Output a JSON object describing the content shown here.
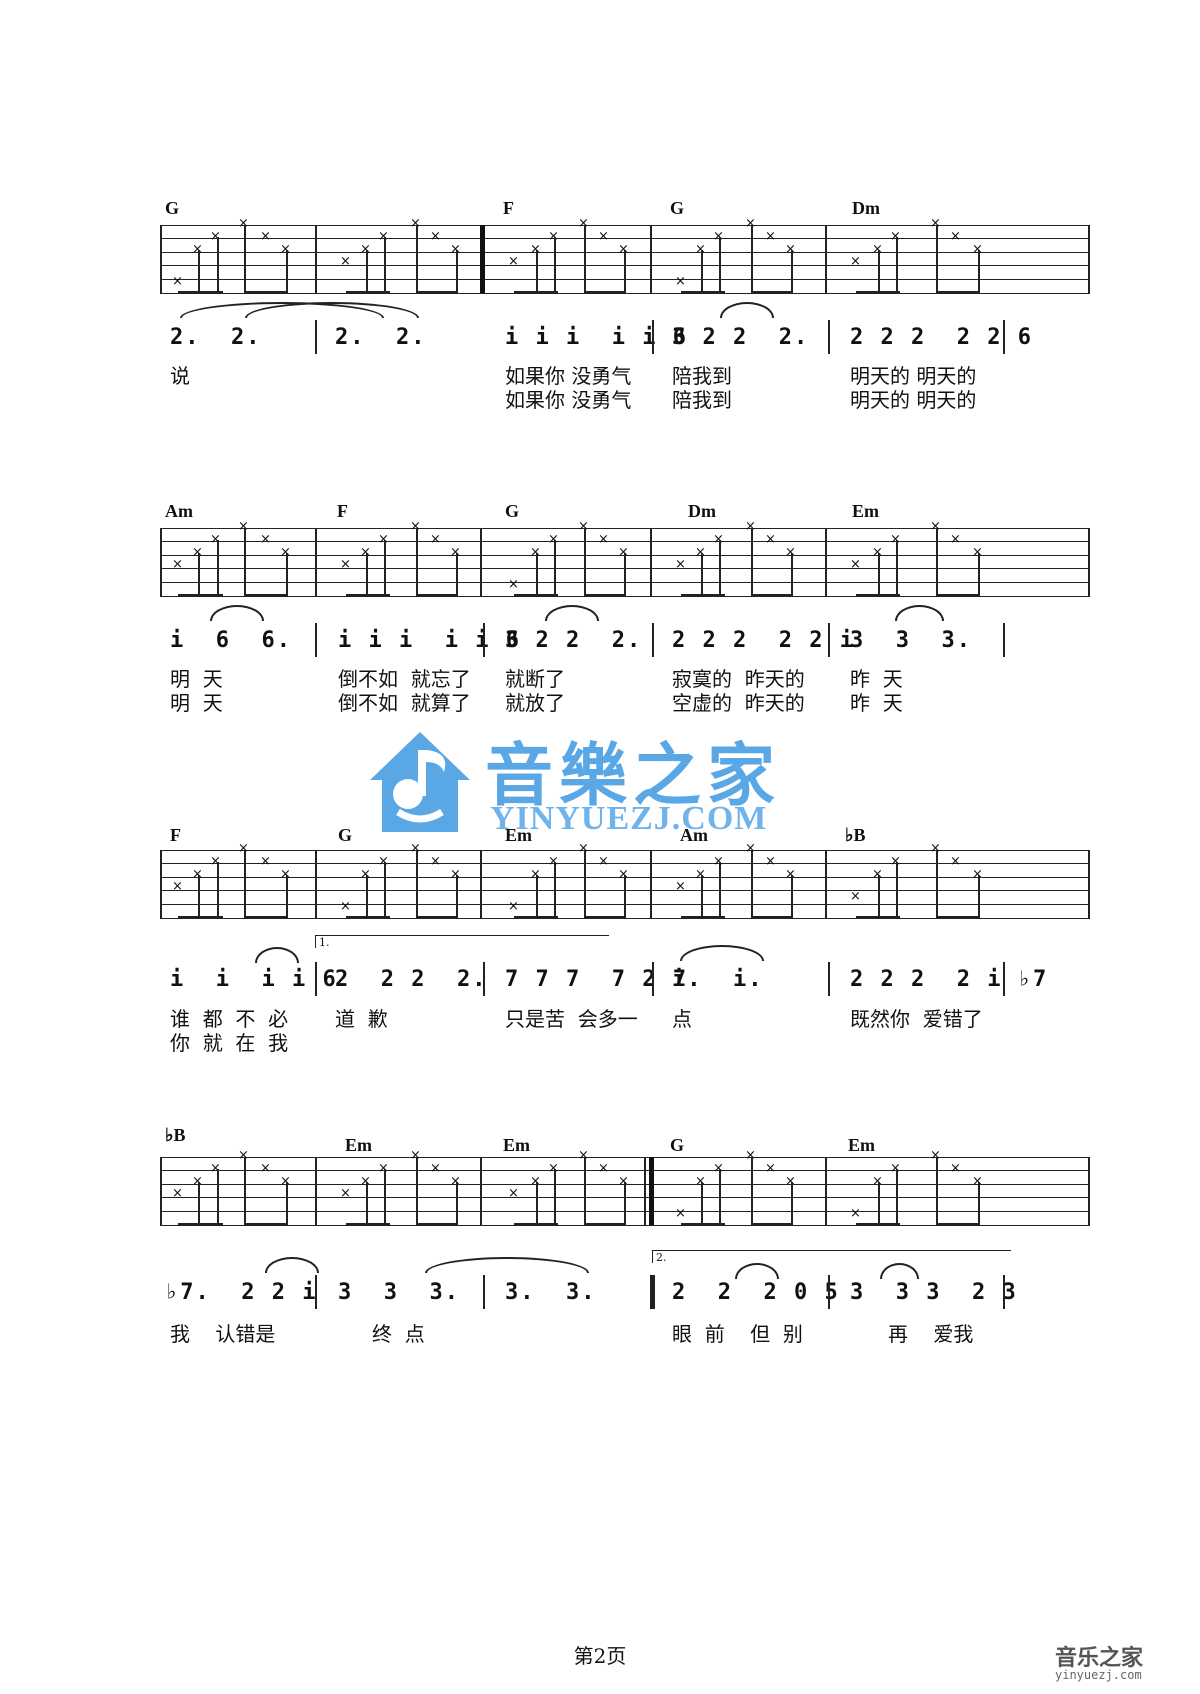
{
  "systems": [
    {
      "chords": [
        "G",
        "F",
        "G",
        "Dm"
      ],
      "jianpu_measures": [
        "2.  2.",
        "2.  2.",
        "i i i  i i 6",
        "3 2 2  2.",
        "2 2 2  2 2 6"
      ],
      "lyrics1": [
        "说",
        "如果你 没勇气",
        "陪我到",
        "明天的 明天的"
      ],
      "lyrics2": [
        "",
        "如果你 没勇气",
        "陪我到",
        "明天的 明天的"
      ]
    },
    {
      "chords": [
        "Am",
        "F",
        "G",
        "Dm",
        "Em"
      ],
      "jianpu_measures": [
        "i  6  6.",
        "i i i  i i 6",
        "3 2 2  2.",
        "2 2 2  2 2 i",
        "3  3  3."
      ],
      "lyrics1": [
        "明  天",
        "倒不如  就忘了",
        "就断了",
        "寂寞的  昨天的",
        "昨  天"
      ],
      "lyrics2": [
        "明  天",
        "倒不如  就算了",
        "就放了",
        "空虚的  昨天的",
        "昨  天"
      ]
    },
    {
      "chords": [
        "F",
        "G",
        "Em",
        "Am",
        "♭B"
      ],
      "ending_label": "1.",
      "jianpu_measures": [
        "i  i  i i 6",
        "2  2 2  2.",
        "7 7 7  7 2 7",
        "i.  i.",
        "2 2 2  2 i ♭7"
      ],
      "lyrics1": [
        "谁  都  不  必",
        "道  歉",
        "只是苦  会多一",
        "点",
        "既然你  爱错了"
      ],
      "lyrics2": [
        "你  就  在  我",
        "",
        "",
        "",
        ""
      ]
    },
    {
      "chords": [
        "♭B",
        "Em",
        "Em",
        "G",
        "Em"
      ],
      "ending_label": "2.",
      "jianpu_measures": [
        "♭7.  2 2 i",
        "3  3  3.",
        "3.  3.",
        "2  2  2 0 5",
        "3  3 3  2 3"
      ],
      "lyrics1": [
        "我    认错是",
        "终  点",
        "",
        "眼  前    但  别",
        "再    爱我"
      ],
      "lyrics2": [
        "",
        "",
        "",
        "",
        ""
      ]
    }
  ],
  "watermark": {
    "brand": "音樂之家",
    "url": "YINYUEZJ.COM"
  },
  "footer": {
    "page": "第2页",
    "corner_brand": "音乐之家",
    "corner_url": "yinyuezj.com"
  }
}
